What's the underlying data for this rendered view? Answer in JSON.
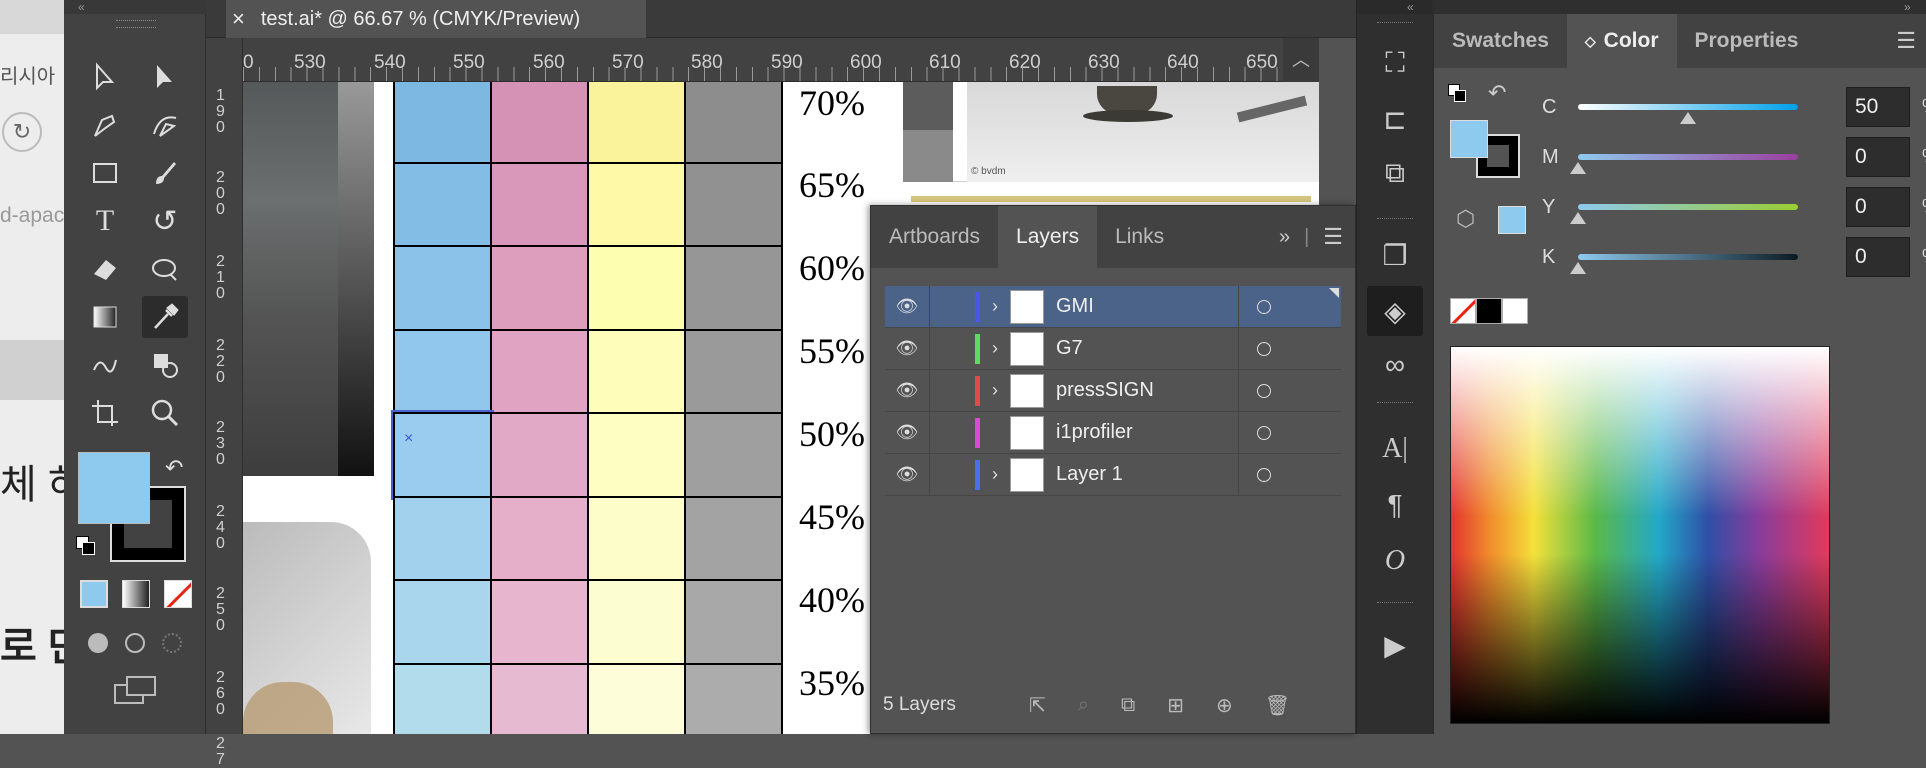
{
  "browser": {
    "text1": "리시아",
    "text2": "d-apac",
    "text3": "체 하",
    "text4": "로 만"
  },
  "document": {
    "tab_title": "test.ai* @ 66.67 % (CMYK/Preview)",
    "close_glyph": "×"
  },
  "ruler": {
    "h_labels": [
      "0",
      "530",
      "540",
      "550",
      "560",
      "570",
      "580",
      "590",
      "600",
      "610",
      "620",
      "630",
      "640",
      "650"
    ],
    "v_labels": [
      "1 9 0",
      "2 0 0",
      "2 1 0",
      "2 2 0",
      "2 3 0",
      "2 4 0",
      "2 5 0",
      "2 6 0",
      "2 7"
    ]
  },
  "canvas": {
    "percents": [
      "70%",
      "65%",
      "60%",
      "55%",
      "50%",
      "45%",
      "40%",
      "35%"
    ],
    "photo_credit": "© bvdm",
    "colors": {
      "cyan": "#7cb8e2",
      "magenta": "#d692b4",
      "yellow": "#fbf29c",
      "gray": "#8d8d8d"
    }
  },
  "layers_panel": {
    "tabs": [
      "Artboards",
      "Layers",
      "Links"
    ],
    "active_tab": "Layers",
    "layers": [
      {
        "name": "GMI",
        "color": "#4a56e8",
        "expand": true,
        "selected": true
      },
      {
        "name": "G7",
        "color": "#5edb5e",
        "expand": true,
        "selected": false
      },
      {
        "name": "pressSIGN",
        "color": "#e24a4a",
        "expand": true,
        "selected": false
      },
      {
        "name": "i1profiler",
        "color": "#d94ad9",
        "expand": false,
        "selected": false
      },
      {
        "name": "Layer 1",
        "color": "#4a6fe8",
        "expand": true,
        "selected": false
      }
    ],
    "count_label": "5 Layers"
  },
  "color_panel": {
    "tabs": [
      "Swatches",
      "Color",
      "Properties"
    ],
    "active_tab": "Color",
    "fill_color": "#8ec9ee",
    "channels": [
      {
        "label": "C",
        "value": "50",
        "unit": "%",
        "level": 0.5
      },
      {
        "label": "M",
        "value": "0",
        "unit": "%",
        "level": 0
      },
      {
        "label": "Y",
        "value": "0",
        "unit": "%",
        "level": 0
      },
      {
        "label": "K",
        "value": "0",
        "unit": "%",
        "level": 0
      }
    ]
  }
}
